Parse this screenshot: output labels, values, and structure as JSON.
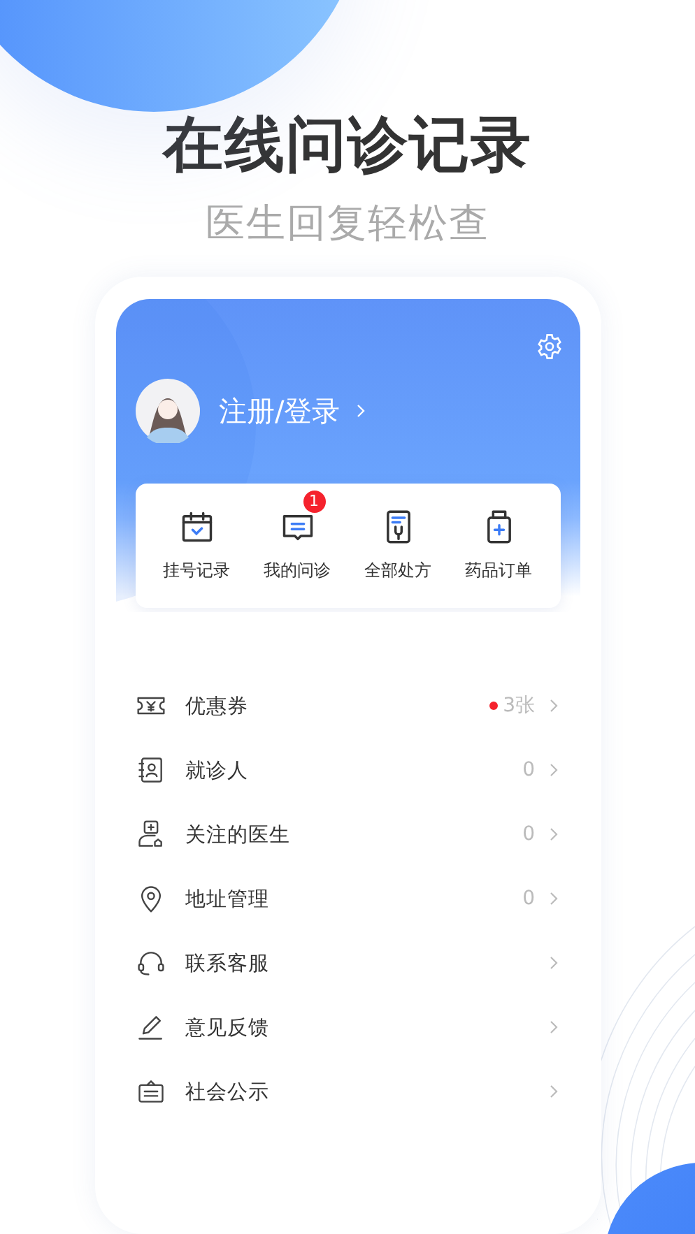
{
  "headline": "在线问诊记录",
  "subtitle": "医生回复轻松查",
  "profile": {
    "login_label": "注册/登录"
  },
  "shortcuts": [
    {
      "kind": "calendar",
      "label": "挂号记录"
    },
    {
      "kind": "chat",
      "label": "我的问诊",
      "badge": "1"
    },
    {
      "kind": "prescription",
      "label": "全部处方"
    },
    {
      "kind": "medicine",
      "label": "药品订单"
    }
  ],
  "menu": [
    {
      "kind": "coupon",
      "label": "优惠券",
      "value": "3张",
      "dot": true
    },
    {
      "kind": "patient",
      "label": "就诊人",
      "value": "0",
      "dot": false
    },
    {
      "kind": "doctor",
      "label": "关注的医生",
      "value": "0",
      "dot": false
    },
    {
      "kind": "address",
      "label": "地址管理",
      "value": "0",
      "dot": false
    },
    {
      "kind": "service",
      "label": "联系客服",
      "dot": false
    },
    {
      "kind": "feedback",
      "label": "意见反馈",
      "dot": false
    },
    {
      "kind": "notice",
      "label": "社会公示",
      "dot": false
    }
  ]
}
